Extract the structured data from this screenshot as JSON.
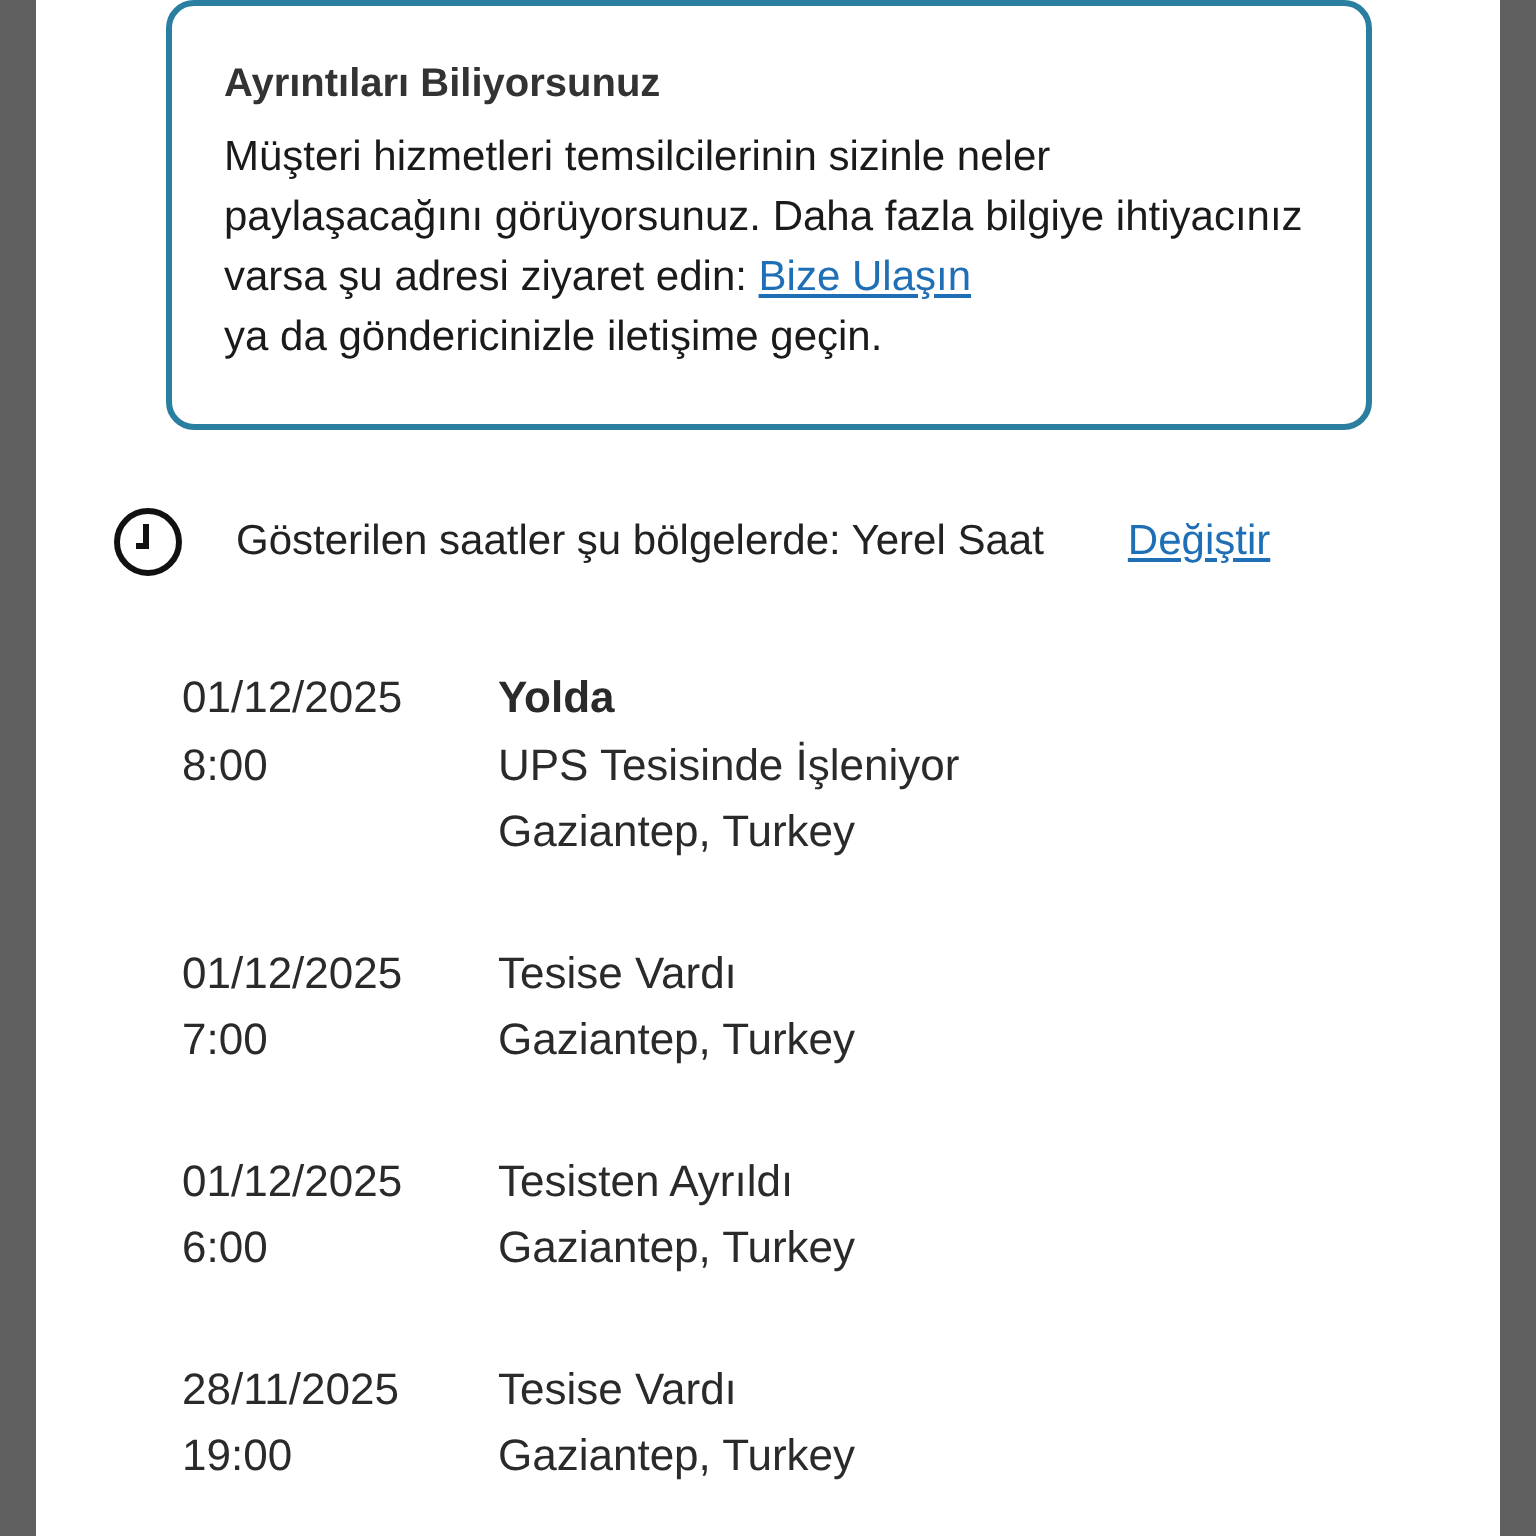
{
  "info_card": {
    "title": "Ayrıntıları Biliyorsunuz",
    "text_before": "Müşteri hizmetleri temsilcilerinin sizinle neler paylaşacağını görüyorsunuz. Daha fazla bilgiye ihtiyacınız varsa şu adresi ziyaret edin: ",
    "link": "Bize Ulaşın",
    "text_after": " ya da göndericinizle iletişime geçin."
  },
  "timezone": {
    "text": "Gösterilen saatler şu bölgelerde: Yerel Saat",
    "link": "Değiştir"
  },
  "events": [
    {
      "date": "01/12/2025",
      "time": "8:00",
      "status": "Yolda",
      "current": true,
      "details": [
        "UPS Tesisinde İşleniyor",
        "Gaziantep, Turkey"
      ]
    },
    {
      "date": "01/12/2025",
      "time": "7:00",
      "status": "Tesise Vardı",
      "current": false,
      "details": [
        "Gaziantep, Turkey"
      ]
    },
    {
      "date": "01/12/2025",
      "time": "6:00",
      "status": "Tesisten Ayrıldı",
      "current": false,
      "details": [
        "Gaziantep, Turkey"
      ]
    },
    {
      "date": "28/11/2025",
      "time": "19:00",
      "status": "Tesise Vardı",
      "current": false,
      "details": [
        "Gaziantep, Turkey"
      ]
    }
  ]
}
